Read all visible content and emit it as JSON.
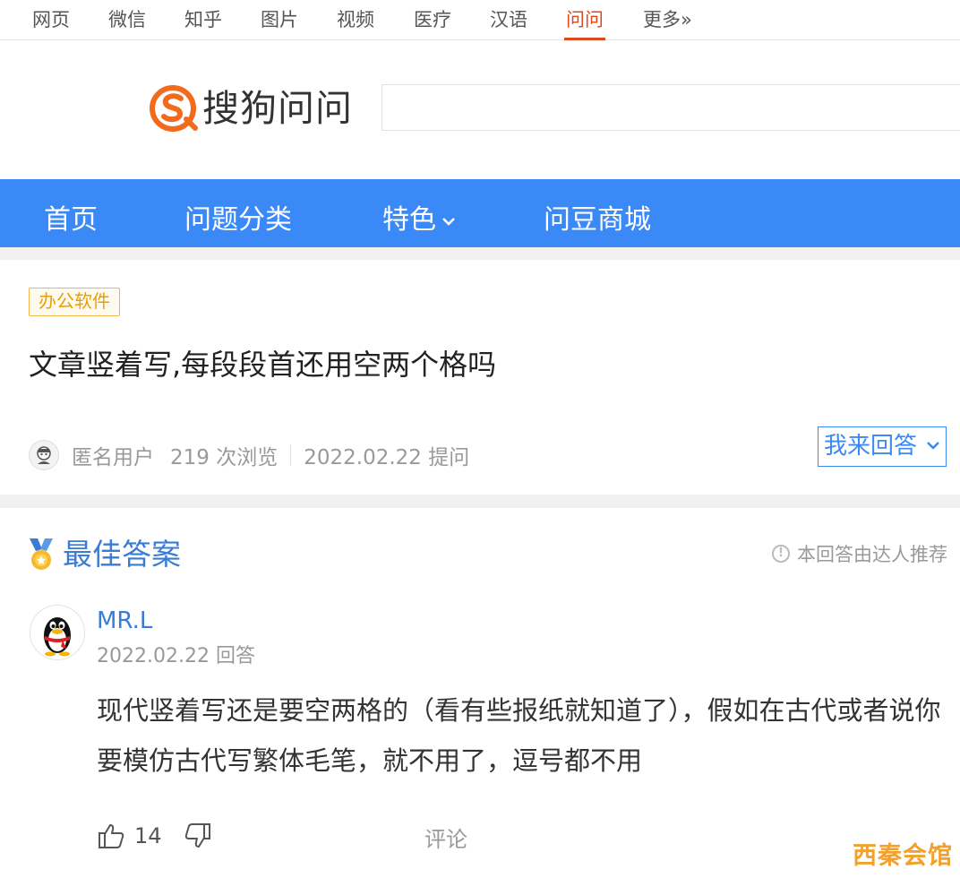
{
  "top_nav": {
    "items": [
      "网页",
      "微信",
      "知乎",
      "图片",
      "视频",
      "医疗",
      "汉语",
      "问问",
      "更多»"
    ],
    "active": "问问"
  },
  "header": {
    "logo_text": "搜狗问问",
    "search_placeholder": ""
  },
  "main_nav": {
    "items": [
      "首页",
      "问题分类",
      "特色",
      "问豆商城"
    ]
  },
  "question": {
    "category_tag": "办公软件",
    "title": "文章竖着写,每段段首还用空两个格吗",
    "asker": "匿名用户",
    "views": "219 次浏览",
    "date": "2022.02.22 提问",
    "answer_button": "我来回答"
  },
  "best_answer": {
    "heading": "最佳答案",
    "recommend_note": "本回答由达人推荐",
    "user": "MR.L",
    "date": "2022.02.22 回答",
    "text": "现代竖着写还是要空两格的（看有些报纸就知道了），假如在古代或者说你要模仿古代写繁体毛笔，就不用了，逗号都不用",
    "likes": "14",
    "comment_label": "评论"
  },
  "watermark": "西秦会馆",
  "colors": {
    "brand_blue": "#3a89f6",
    "active_orange": "#e0471b",
    "logo_orange": "#f26b1d",
    "tag_gold": "#e8a000",
    "link_blue": "#3a7bd5"
  }
}
